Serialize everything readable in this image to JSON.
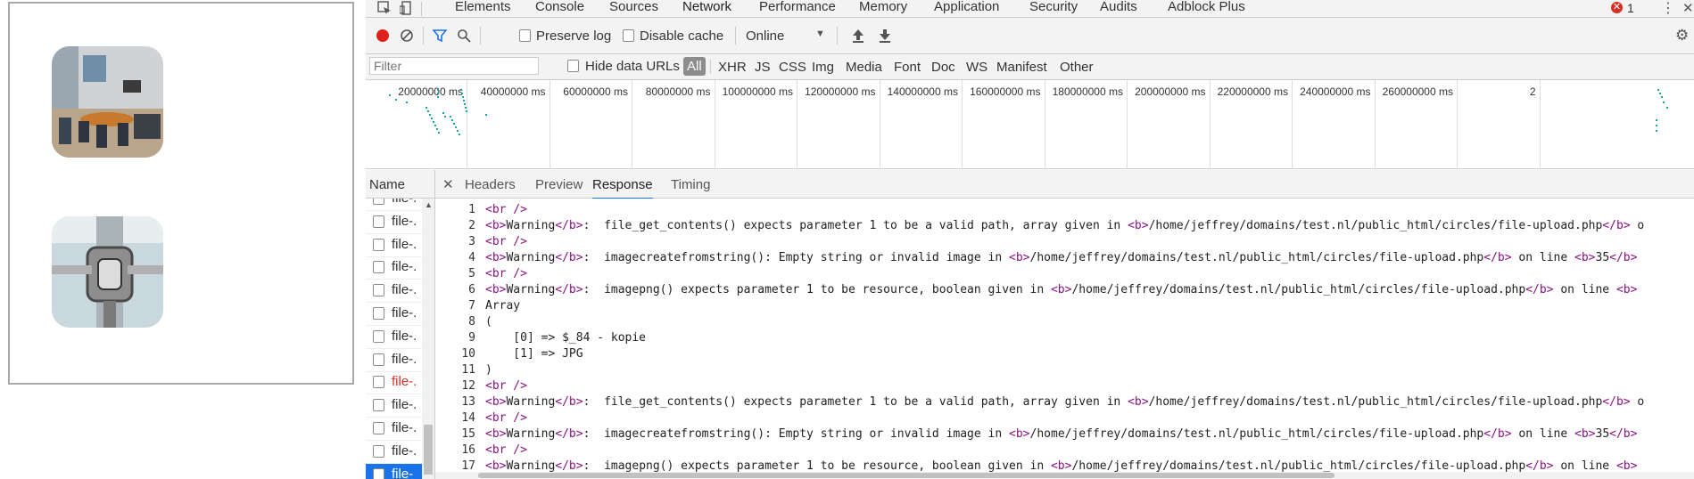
{
  "devtools": {
    "tabs": [
      "Elements",
      "Console",
      "Sources",
      "Network",
      "Performance",
      "Memory",
      "Application",
      "Security",
      "Audits",
      "Adblock Plus"
    ],
    "active_tab": "Network",
    "error_count": "1",
    "toolbar": {
      "preserve_log_label": "Preserve log",
      "disable_cache_label": "Disable cache",
      "throttle_value": "Online"
    },
    "filter": {
      "placeholder": "Filter",
      "hide_data_urls_label": "Hide data URLs",
      "types": [
        "All",
        "XHR",
        "JS",
        "CSS",
        "Img",
        "Media",
        "Font",
        "Doc",
        "WS",
        "Manifest",
        "Other"
      ]
    },
    "overview_ticks": [
      "20000000 ms",
      "40000000 ms",
      "60000000 ms",
      "80000000 ms",
      "100000000 ms",
      "120000000 ms",
      "140000000 ms",
      "160000000 ms",
      "180000000 ms",
      "200000000 ms",
      "220000000 ms",
      "240000000 ms",
      "260000000 ms",
      "2"
    ],
    "name_header": "Name",
    "detail_tabs": [
      "Headers",
      "Preview",
      "Response",
      "Timing"
    ],
    "active_detail_tab": "Response",
    "files": [
      "file-.",
      "file-.",
      "file-.",
      "file-.",
      "file-.",
      "file-.",
      "file-.",
      "file-.",
      "file-.",
      "file-.",
      "file-.",
      "file-.",
      "file-"
    ],
    "error_file_index": 8,
    "response_lines": [
      {
        "n": "1",
        "parts": [
          [
            "tag",
            "<br />"
          ]
        ]
      },
      {
        "n": "2",
        "parts": [
          [
            "tag",
            "<b>"
          ],
          [
            "txt",
            "Warning"
          ],
          [
            "tag",
            "</b>"
          ],
          [
            "txt",
            ":  file_get_contents() expects parameter 1 to be a valid path, array given in "
          ],
          [
            "tag",
            "<b>"
          ],
          [
            "txt",
            "/home/jeffrey/domains/test.nl/public_html/circles/file-upload.php"
          ],
          [
            "tag",
            "</b>"
          ],
          [
            "txt",
            " o"
          ]
        ]
      },
      {
        "n": "3",
        "parts": [
          [
            "tag",
            "<br />"
          ]
        ]
      },
      {
        "n": "4",
        "parts": [
          [
            "tag",
            "<b>"
          ],
          [
            "txt",
            "Warning"
          ],
          [
            "tag",
            "</b>"
          ],
          [
            "txt",
            ":  imagecreatefromstring(): Empty string or invalid image in "
          ],
          [
            "tag",
            "<b>"
          ],
          [
            "txt",
            "/home/jeffrey/domains/test.nl/public_html/circles/file-upload.php"
          ],
          [
            "tag",
            "</b>"
          ],
          [
            "txt",
            " on line "
          ],
          [
            "tag",
            "<b>"
          ],
          [
            "txt",
            "35"
          ],
          [
            "tag",
            "</b>"
          ]
        ]
      },
      {
        "n": "5",
        "parts": [
          [
            "tag",
            "<br />"
          ]
        ]
      },
      {
        "n": "6",
        "parts": [
          [
            "tag",
            "<b>"
          ],
          [
            "txt",
            "Warning"
          ],
          [
            "tag",
            "</b>"
          ],
          [
            "txt",
            ":  imagepng() expects parameter 1 to be resource, boolean given in "
          ],
          [
            "tag",
            "<b>"
          ],
          [
            "txt",
            "/home/jeffrey/domains/test.nl/public_html/circles/file-upload.php"
          ],
          [
            "tag",
            "</b>"
          ],
          [
            "txt",
            " on line "
          ],
          [
            "tag",
            "<b>"
          ]
        ]
      },
      {
        "n": "7",
        "parts": [
          [
            "txt",
            "Array"
          ]
        ]
      },
      {
        "n": "8",
        "parts": [
          [
            "txt",
            "("
          ]
        ]
      },
      {
        "n": "9",
        "parts": [
          [
            "txt",
            "    [0] => $_84 - kopie"
          ]
        ]
      },
      {
        "n": "10",
        "parts": [
          [
            "txt",
            "    [1] => JPG"
          ]
        ]
      },
      {
        "n": "11",
        "parts": [
          [
            "txt",
            ")"
          ]
        ]
      },
      {
        "n": "12",
        "parts": [
          [
            "tag",
            "<br />"
          ]
        ]
      },
      {
        "n": "13",
        "parts": [
          [
            "tag",
            "<b>"
          ],
          [
            "txt",
            "Warning"
          ],
          [
            "tag",
            "</b>"
          ],
          [
            "txt",
            ":  file_get_contents() expects parameter 1 to be a valid path, array given in "
          ],
          [
            "tag",
            "<b>"
          ],
          [
            "txt",
            "/home/jeffrey/domains/test.nl/public_html/circles/file-upload.php"
          ],
          [
            "tag",
            "</b>"
          ],
          [
            "txt",
            " o"
          ]
        ]
      },
      {
        "n": "14",
        "parts": [
          [
            "tag",
            "<br />"
          ]
        ]
      },
      {
        "n": "15",
        "parts": [
          [
            "tag",
            "<b>"
          ],
          [
            "txt",
            "Warning"
          ],
          [
            "tag",
            "</b>"
          ],
          [
            "txt",
            ":  imagecreatefromstring(): Empty string or invalid image in "
          ],
          [
            "tag",
            "<b>"
          ],
          [
            "txt",
            "/home/jeffrey/domains/test.nl/public_html/circles/file-upload.php"
          ],
          [
            "tag",
            "</b>"
          ],
          [
            "txt",
            " on line "
          ],
          [
            "tag",
            "<b>"
          ],
          [
            "txt",
            "35"
          ],
          [
            "tag",
            "</b>"
          ]
        ]
      },
      {
        "n": "16",
        "parts": [
          [
            "tag",
            "<br />"
          ]
        ]
      },
      {
        "n": "17",
        "parts": [
          [
            "tag",
            "<b>"
          ],
          [
            "txt",
            "Warning"
          ],
          [
            "tag",
            "</b>"
          ],
          [
            "txt",
            ":  imagepng() expects parameter 1 to be resource, boolean given in "
          ],
          [
            "tag",
            "<b>"
          ],
          [
            "txt",
            "/home/jeffrey/domains/test.nl/public_html/circles/file-upload.php"
          ],
          [
            "tag",
            "</b>"
          ],
          [
            "txt",
            " on line "
          ],
          [
            "tag",
            "<b>"
          ]
        ]
      }
    ],
    "colors": {
      "accent": "#1a73e8",
      "record_red": "#e0201b",
      "tag_purple": "#881280",
      "waterfall_teal": "#1aa3a3",
      "error_red": "#d93025"
    }
  }
}
